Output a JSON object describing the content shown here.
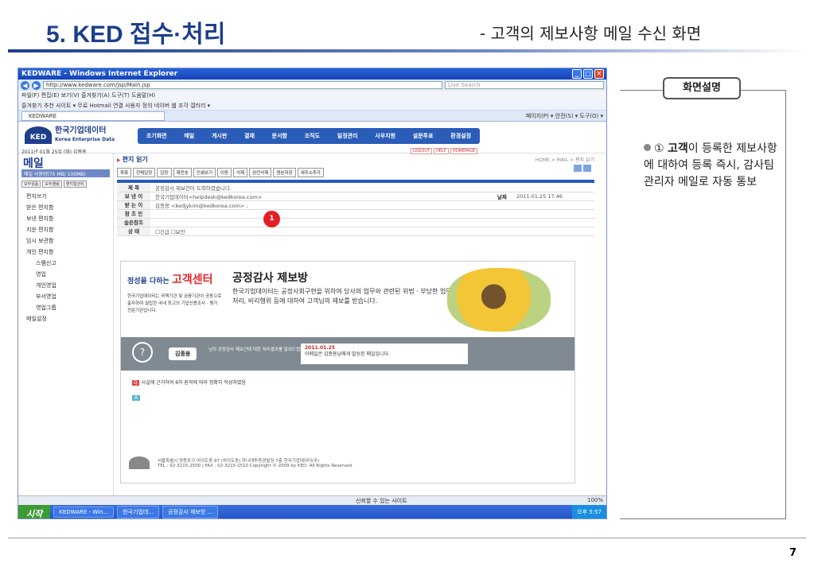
{
  "slide": {
    "title": "5. KED 접수·처리",
    "subtitle": "- 고객의 제보사항 메일 수신 화면",
    "page_number": "7"
  },
  "browser": {
    "window_title": "KEDWARE - Windows Internet Explorer",
    "url": "http://www.kedware.com/jsp/Main.jsp",
    "search_placeholder": "Live Search",
    "menu": "파일(F)  편집(E)  보기(V)  즐겨찾기(A)  도구(T)  도움말(H)",
    "favorites": "즐겨찾기   추천 사이트 ▾   무료 Hotmail   연결 사용자 정의   네이버   웹 조각 갤러리 ▾",
    "tab_label": "KEDWARE",
    "tools": "페이지(P) ▾  안전(S) ▾  도구(O) ▾",
    "status_text": "신뢰할 수 있는 사이트",
    "zoom": "100%"
  },
  "ked": {
    "logo_kr": "한국기업데이터",
    "logo_en": "Korea Enterprise Data",
    "date_line": "2011년 01월 25일 (화)  김종용",
    "nav": [
      "초기화면",
      "메일",
      "게시판",
      "결재",
      "문서함",
      "조직도",
      "일정관리",
      "사우지원",
      "설문투표",
      "환경설정"
    ],
    "small_nav": [
      "LOGOUT",
      "HELP",
      "HOMEPAGE"
    ],
    "sidebar_title": "메일",
    "usage": "메일 사용량(75 MB/ 100MB)",
    "side_buttons": [
      "모두읽음",
      "모두열림",
      "편지함관리"
    ],
    "folders": [
      "편지쓰기",
      "받은 편지함",
      "보낸 편지함",
      "지운 편지함",
      "임시 보관함",
      "개인 편지함"
    ],
    "subfolders": [
      "스팸신고",
      "영업",
      "개인영업",
      "부서영업",
      "영업그룹",
      "메일설정"
    ]
  },
  "mail": {
    "title": "편지 읽기",
    "breadcrumb": "HOME > MAIL > 편지 읽기",
    "toolbar": [
      "목록",
      "전체답장",
      "답장",
      "재전송",
      "인쇄보기",
      "이동",
      "삭제",
      "완전삭제",
      "원본저장",
      "새주소추가"
    ],
    "labels": {
      "subject": "제 목",
      "sender": "보 낸 이",
      "receiver": "받 는 이",
      "cc": "참 조 인",
      "bcc": "숨은참조",
      "status": "상 태",
      "date": "날짜"
    },
    "subject": "공정감사 제보건이 도착하였습니다.",
    "sender": "한국기업데이터<helpdesk@kedkorea.com>",
    "receiver": "김종용 <kedjykim@kedkorea.com> ;",
    "date": "2011.01.25 17:46",
    "status_opts": "☐긴급  ☐보안",
    "badge": "1"
  },
  "banner": {
    "slogan_prefix": "정성을 다하는",
    "slogan_main": "고객센터",
    "slogan_small": "한국기업데이터는 국책기관 및 금융기관이 공동으로 출자하여 설립한 국내 최고의 기업신용조사 · 평가 전문기관입니다.",
    "title": "공정감사 제보방",
    "text": "한국기업데이터는 공정사회구현을 위하여 당사의 업무와 관련된 위법 · 부당한 업무처리, 비리행위 등에 대하여 고객님의 제보를 받습니다.",
    "name": "김종용",
    "mid_text": "님의 공정감사 제보건에 대한 처리결과를 알려드립니다.",
    "mid_date": "2011.01.25",
    "mid_date_text": "이메일은 김종용님에게 발송된 메일입니다.",
    "q_text": "사실에 근거하여 6하 원칙에 따라 정확히 작성하였음",
    "a_label": "A",
    "q_label": "Q",
    "footer_addr": "서울특별시 영등포구 여의도동 97 (여의도동) 하나대투증권빌딩 7층 한국기업데이터(주)",
    "footer_tel": "TEL : 02-3215-2500  |  FAX : 02-3215-2510  Copyright © 2009 by KED. All Rights Reserved."
  },
  "taskbar": {
    "start": "시작",
    "tasks": [
      "KEDWARE - Win...",
      "한국기업데...",
      "공정감사 제보방 ..."
    ],
    "clock": "오후 5:57"
  },
  "panel": {
    "heading": "화면설명",
    "desc_number": "①",
    "desc_bold": "고객",
    "desc_text": "이 등록한 제보사항에 대하여 등록 즉시, 감사팀 관리자 메일로 자동 통보"
  }
}
